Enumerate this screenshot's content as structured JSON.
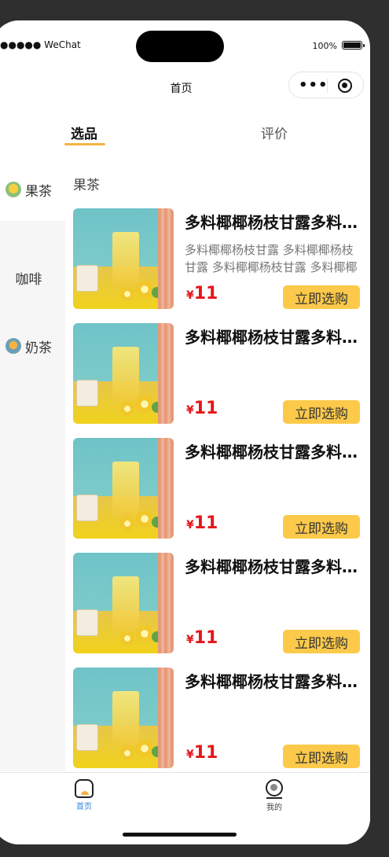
{
  "status_bar": {
    "carrier": "●●●●● WeChat",
    "wifi_icon": "wifi-icon",
    "battery": "100%"
  },
  "nav": {
    "title": "首页",
    "capsule_more": "•••",
    "capsule_close_icon": "target-icon"
  },
  "tabs": [
    {
      "label": "选品",
      "active": true
    },
    {
      "label": "评价",
      "active": false
    }
  ],
  "sidebar": {
    "items": [
      {
        "label": "果茶",
        "icon": "fruit-tea-icon",
        "active": true
      },
      {
        "label": "咖啡",
        "icon": "",
        "active": false
      },
      {
        "label": "奶茶",
        "icon": "milk-tea-icon",
        "active": false
      }
    ]
  },
  "category": {
    "title": "果茶"
  },
  "products": [
    {
      "name": "多料椰椰杨枝甘露多料椰椰杨枝甘露",
      "desc": "多料椰椰杨枝甘露 多料椰椰杨枝甘露 多料椰椰杨枝甘露 多料椰椰杨枝甘露",
      "currency": "¥",
      "price": "11",
      "button": "立即选购"
    },
    {
      "name": "多料椰椰杨枝甘露多料椰椰杨枝甘露",
      "desc": "",
      "currency": "¥",
      "price": "11",
      "button": "立即选购"
    },
    {
      "name": "多料椰椰杨枝甘露多料椰椰杨枝甘露",
      "desc": "",
      "currency": "¥",
      "price": "11",
      "button": "立即选购"
    },
    {
      "name": "多料椰椰杨枝甘露多料椰椰杨枝甘露",
      "desc": "",
      "currency": "¥",
      "price": "11",
      "button": "立即选购"
    },
    {
      "name": "多料椰椰杨枝甘露多料椰椰杨枝甘露",
      "desc": "",
      "currency": "¥",
      "price": "11",
      "button": "立即选购"
    }
  ],
  "tabbar": {
    "items": [
      {
        "label": "首页",
        "icon": "home-icon",
        "active": true
      },
      {
        "label": "我的",
        "icon": "profile-icon",
        "active": false
      }
    ]
  },
  "colors": {
    "accent": "#f5b342",
    "button": "#fcc94a",
    "price": "#e4161a",
    "active_tab_label": "#2e86de"
  }
}
